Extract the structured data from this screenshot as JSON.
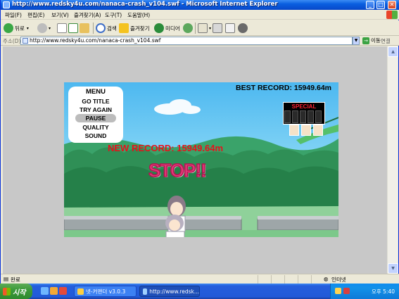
{
  "window": {
    "title": "http://www.redsky4u.com/nanaca-crash_v104.swf - Microsoft Internet Explorer",
    "minimize": "_",
    "maximize": "□",
    "close": "✕"
  },
  "menubar": {
    "items": [
      "파일(F)",
      "편집(E)",
      "보기(V)",
      "즐겨찾기(A)",
      "도구(T)",
      "도움말(H)"
    ]
  },
  "toolbar": {
    "back_label": "뒤로",
    "search_label": "검색",
    "favorites_label": "즐겨찾기",
    "media_label": "미디어"
  },
  "addressbar": {
    "label": "주소(D)",
    "url": "http://www.redsky4u.com/nanaca-crash_v104.swf",
    "go_label": "이동",
    "links_label": "연결"
  },
  "game": {
    "menu_title": "MENU",
    "menu_items": [
      "GO TITLE",
      "TRY AGAIN",
      "PAUSE",
      "QUALITY",
      "SOUND"
    ],
    "best_record": "BEST RECORD:  15949.64m",
    "new_record": "NEW RECORD:  15949.64m",
    "stop_text": "STOP!!",
    "special_label": "SPECIAL"
  },
  "statusbar": {
    "status_text": "완료",
    "zone_text": "인터넷"
  },
  "taskbar": {
    "start_label": "시작",
    "tasks": [
      "넷-커맨더 v3.0.3",
      "http://www.redsk..."
    ],
    "clock": "오후 5:40"
  },
  "colors": {
    "title_blue": "#0a5fe0",
    "new_record_red": "#e8101a",
    "stop_pink": "#e23a7a",
    "start_green": "#3c9a3b"
  }
}
